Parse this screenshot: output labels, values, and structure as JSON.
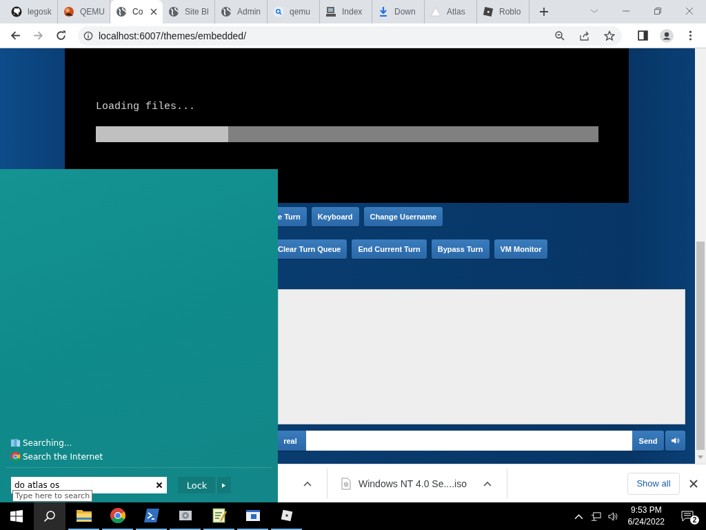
{
  "browser": {
    "tabs": [
      {
        "title": "legosk",
        "kind": "github",
        "selected": false
      },
      {
        "title": "QEMU",
        "kind": "ball",
        "selected": false
      },
      {
        "title": "Co",
        "kind": "globe",
        "selected": true
      },
      {
        "title": "Site Bl",
        "kind": "globe",
        "selected": false
      },
      {
        "title": "Admin",
        "kind": "globe",
        "selected": false
      },
      {
        "title": "qemu",
        "kind": "search",
        "selected": false
      },
      {
        "title": "Index",
        "kind": "computer",
        "selected": false
      },
      {
        "title": "Down",
        "kind": "download",
        "selected": false
      },
      {
        "title": "Atlas",
        "kind": "triangle",
        "selected": false
      },
      {
        "title": "Roblo",
        "kind": "square",
        "selected": false
      }
    ],
    "address": "localhost:6007/themes/embedded/"
  },
  "vm": {
    "screen_text": "Loading files...",
    "progress": {
      "level": 0.263
    }
  },
  "controls": {
    "row_1": [
      "e Turn",
      "Keyboard",
      "Change Username"
    ],
    "row_2": [
      "Clear Turn Queue",
      "End Current Turn",
      "Bypass Turn",
      "VM Monitor"
    ]
  },
  "chat": {
    "mode_button": "real",
    "send_button": "Send"
  },
  "downloads": {
    "items": [
      {
        "name": "Windows NT 4.0 Se....iso"
      }
    ],
    "show_all": "Show all"
  },
  "start_menu": {
    "results": [
      {
        "label": "Searching...",
        "kind": "library"
      },
      {
        "label": "Search the Internet",
        "kind": "chrome"
      }
    ],
    "search": {
      "value": "do atlas os",
      "tooltip": "Type here to search"
    },
    "power_button": "Lock"
  },
  "taskbar": {
    "apps": [
      {
        "kind": "folder"
      },
      {
        "kind": "chrome"
      },
      {
        "kind": "terminal"
      },
      {
        "kind": "disk"
      },
      {
        "kind": "notepad"
      },
      {
        "kind": "window"
      },
      {
        "kind": "square"
      }
    ],
    "clock": {
      "time": "9:53 PM",
      "date": "6/24/2022"
    },
    "notification_count": "2"
  }
}
